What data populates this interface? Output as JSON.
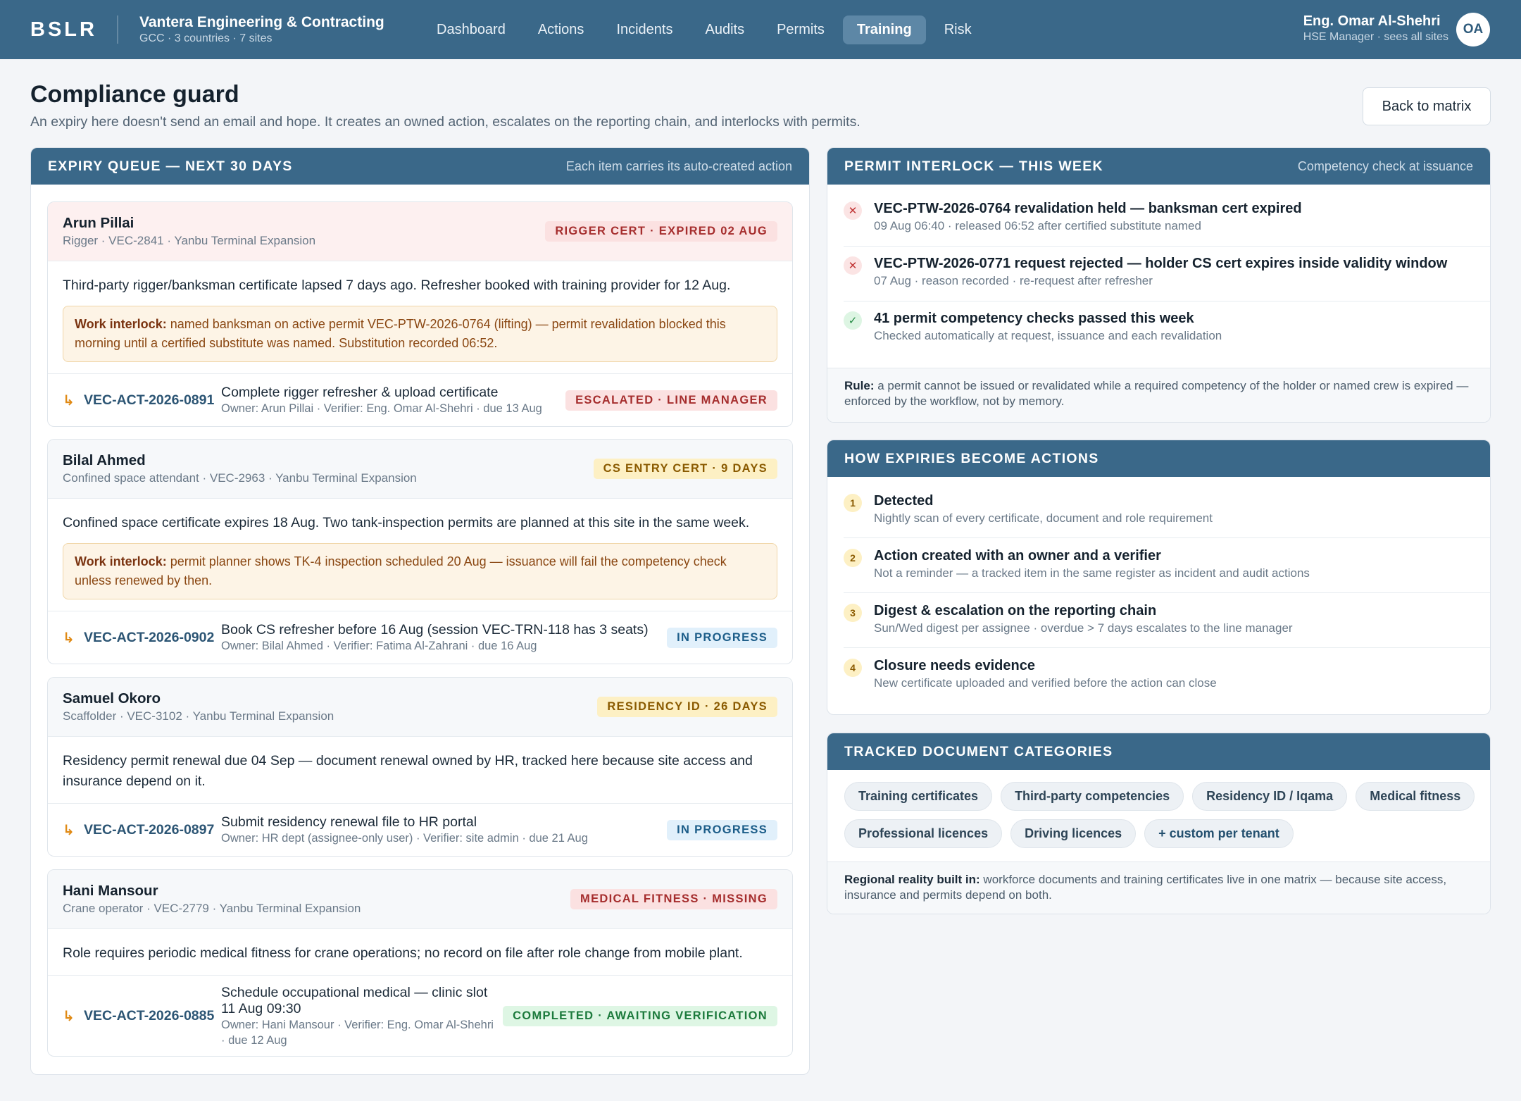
{
  "app": {
    "brand": "BSLR",
    "org_name": "Vantera Engineering & Contracting",
    "org_sub": "GCC · 3 countries · 7 sites"
  },
  "nav": [
    {
      "label": "Dashboard",
      "active": false
    },
    {
      "label": "Actions",
      "active": false
    },
    {
      "label": "Incidents",
      "active": false
    },
    {
      "label": "Audits",
      "active": false
    },
    {
      "label": "Permits",
      "active": false
    },
    {
      "label": "Training",
      "active": true
    },
    {
      "label": "Risk",
      "active": false
    }
  ],
  "user": {
    "name": "Eng. Omar Al-Shehri",
    "role": "HSE Manager · sees all sites",
    "initials": "OA"
  },
  "page": {
    "title": "Compliance guard",
    "subtitle": "An expiry here doesn't send an email and hope. It creates an owned action, escalates on the reporting chain, and interlocks with permits.",
    "back_label": "Back to matrix"
  },
  "expiry": {
    "title": "Expiry queue — next 30 days",
    "note": "Each item carries its auto-created action",
    "interlock_label": "Work interlock:",
    "cards": [
      {
        "name": "Arun Pillai",
        "meta": "Rigger · VEC-2841 · Yanbu Terminal Expansion",
        "badge": "Rigger cert · expired 02 Aug",
        "badge_color": "#a52d2d",
        "text": "Third-party rigger/banksman certificate lapsed 7 days ago. Refresher booked with training provider for 12 Aug.",
        "interlock": "named banksman on active permit VEC-PTW-2026-0764 (lifting) — permit revalidation blocked this morning until a certified substitute was named. Substitution recorded 06:52.",
        "action": {
          "id": "VEC-ACT-2026-0891",
          "title": "Complete rigger refresher & upload certificate",
          "meta": "Owner: Arun Pillai · Verifier: Eng. Omar Al-Shehri · due 13 Aug",
          "status": "Escalated · line manager"
        }
      },
      {
        "name": "Bilal Ahmed",
        "meta": "Confined space attendant · VEC-2963 · Yanbu Terminal Expansion",
        "badge": "CS entry cert · 9 days",
        "badge_color": "#8a5a00",
        "text": "Confined space certificate expires 18 Aug. Two tank-inspection permits are planned at this site in the same week.",
        "interlock": "permit planner shows TK-4 inspection scheduled 20 Aug — issuance will fail the competency check unless renewed by then.",
        "action": {
          "id": "VEC-ACT-2026-0902",
          "title": "Book CS refresher before 16 Aug (session VEC-TRN-118 has 3 seats)",
          "meta": "Owner: Bilal Ahmed · Verifier: Fatima Al-Zahrani · due 16 Aug",
          "status": "In progress"
        }
      },
      {
        "name": "Samuel Okoro",
        "meta": "Scaffolder · VEC-3102 · Yanbu Terminal Expansion",
        "badge": "Residency ID · 26 days",
        "badge_color": "#8a5a00",
        "text": "Residency permit renewal due 04 Sep — document renewal owned by HR, tracked here because site access and insurance depend on it.",
        "action": {
          "id": "VEC-ACT-2026-0897",
          "title": "Submit residency renewal file to HR portal",
          "meta": "Owner: HR dept (assignee-only user) · Verifier: site admin · due 21 Aug",
          "status": "In progress"
        }
      },
      {
        "name": "Hani Mansour",
        "meta": "Crane operator · VEC-2779 · Yanbu Terminal Expansion",
        "badge": "Medical fitness · missing",
        "badge_color": "#a52d2d",
        "text": "Role requires periodic medical fitness for crane operations; no record on file after role change from mobile plant.",
        "action": {
          "id": "VEC-ACT-2026-0885",
          "title": "Schedule occupational medical — clinic slot 11 Aug 09:30",
          "meta": "Owner: Hani Mansour · Verifier: Eng. Omar Al-Shehri · due 12 Aug",
          "status": "Completed · awaiting verification"
        }
      }
    ]
  },
  "permit": {
    "title": "Permit interlock — this week",
    "note": "Competency check at issuance",
    "rows": [
      {
        "icon": "x-icon",
        "glyph": "✕",
        "title": "VEC-PTW-2026-0764 revalidation held — banksman cert expired",
        "sub": "09 Aug 06:40 · released 06:52 after certified substitute named"
      },
      {
        "icon": "x-icon",
        "glyph": "✕",
        "title": "VEC-PTW-2026-0771 request rejected — holder CS cert expires inside validity window",
        "sub": "07 Aug · reason recorded · re-request after refresher"
      },
      {
        "icon": "check-icon",
        "glyph": "✓",
        "title": "41 permit competency checks passed this week",
        "sub": "Checked automatically at request, issuance and each revalidation"
      }
    ],
    "rule_label": "Rule:",
    "rule_text": "a permit cannot be issued or revalidated while a required competency of the holder or named crew is expired — enforced by the workflow, not by memory."
  },
  "how": {
    "title": "How expiries become actions",
    "steps": [
      {
        "n": "1",
        "title": "Detected",
        "sub": "Nightly scan of every certificate, document and role requirement"
      },
      {
        "n": "2",
        "title": "Action created with an owner and a verifier",
        "sub": "Not a reminder — a tracked item in the same register as incident and audit actions"
      },
      {
        "n": "3",
        "title": "Digest & escalation on the reporting chain",
        "sub": "Sun/Wed digest per assignee · overdue > 7 days escalates to the line manager"
      },
      {
        "n": "4",
        "title": "Closure needs evidence",
        "sub": "New certificate uploaded and verified before the action can close"
      }
    ]
  },
  "docs": {
    "title": "Tracked document categories",
    "chips": [
      "Training certificates",
      "Third-party competencies",
      "Residency ID / Iqama",
      "Medical fitness",
      "Professional licences",
      "Driving licences",
      "+ custom per tenant"
    ],
    "footer_label": "Regional reality built in:",
    "footer_text": "workforce documents and training certificates live in one matrix — because site access, insurance and permits depend on both."
  },
  "colors": {
    "primary": "#3a6889",
    "danger": "#a52d2d",
    "warning": "#8a5a00",
    "info": "#1c5d89",
    "success": "#1c7a3c"
  }
}
